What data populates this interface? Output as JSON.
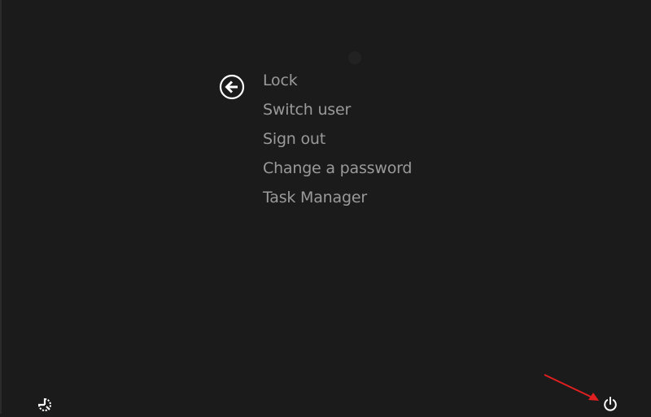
{
  "security_screen": {
    "back_label": "Back",
    "menu": {
      "items": [
        {
          "label": "Lock"
        },
        {
          "label": "Switch user"
        },
        {
          "label": "Sign out"
        },
        {
          "label": "Change a password"
        },
        {
          "label": "Task Manager"
        }
      ]
    },
    "footer": {
      "left_icon": "ease-of-access-icon",
      "right_icon": "power-icon"
    },
    "annotation": {
      "color": "#e02020",
      "points_to": "power-button"
    },
    "colors": {
      "background": "#1b1b1b",
      "menu_text": "#9a9a9a",
      "icon": "#ffffff"
    }
  }
}
